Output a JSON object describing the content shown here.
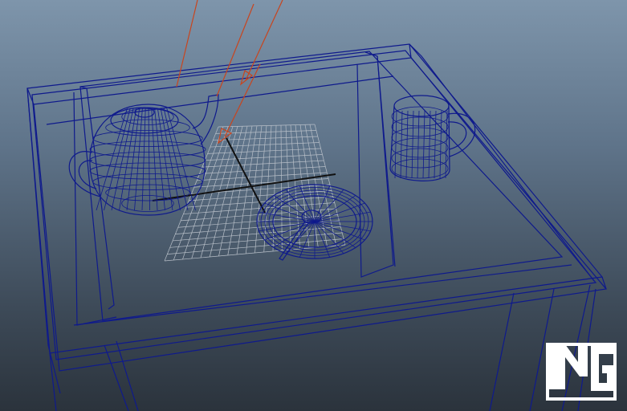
{
  "viewport": {
    "name": "perspective-viewport",
    "colors": {
      "wireframe": "#0f1a8c",
      "grid": "#b8bfc8",
      "axis": "#111111",
      "light": "#c8451e",
      "background_top": "#7e95ab",
      "background_bottom": "#2b333c",
      "watermark": "#ffffff"
    },
    "objects": [
      "table",
      "teapot",
      "mug",
      "plate",
      "spoon",
      "directional-light",
      "ground-grid"
    ],
    "watermark_icon": "ng-logo-icon"
  }
}
